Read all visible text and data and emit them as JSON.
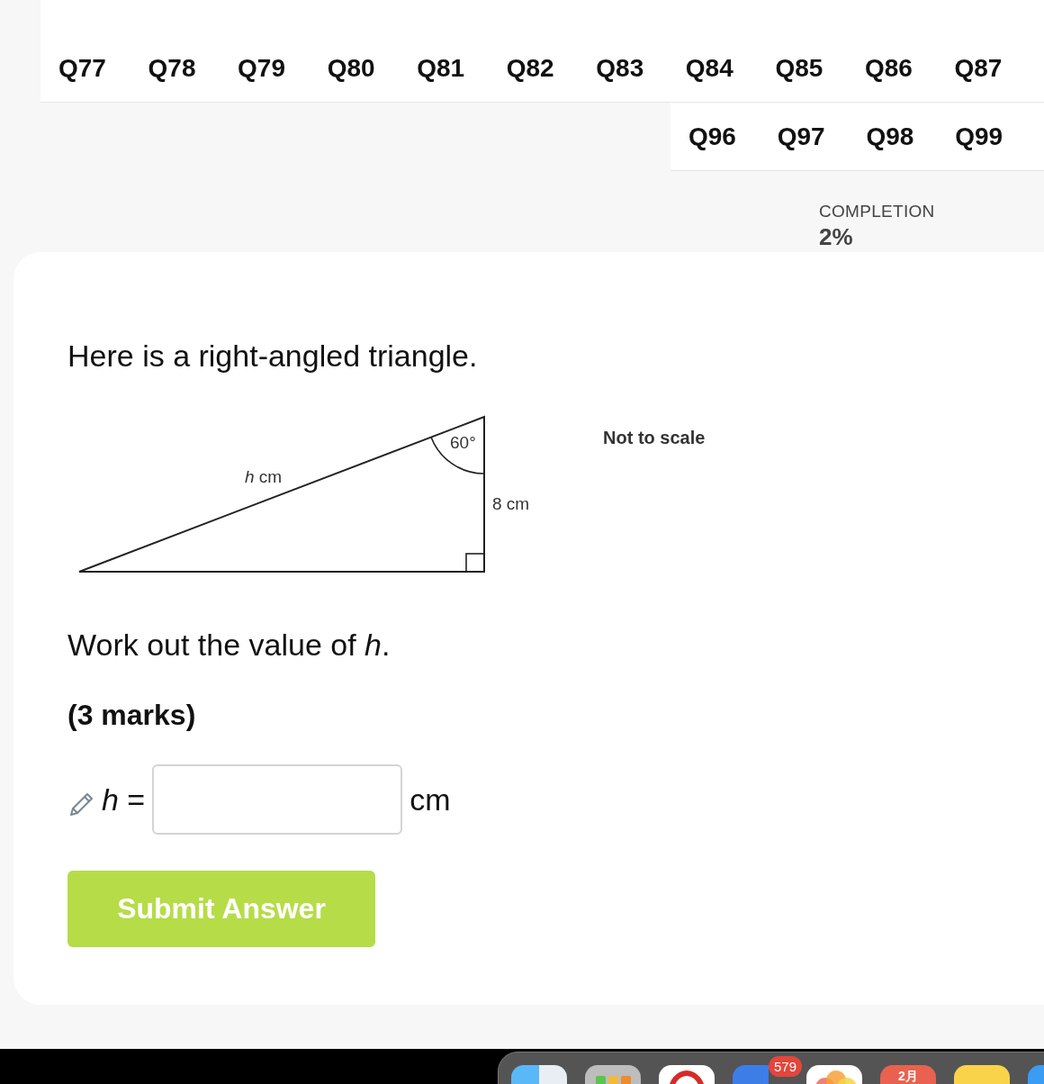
{
  "question_nav": {
    "rows": [
      {
        "items": [
          "Q77",
          "Q78",
          "Q79",
          "Q80",
          "Q81",
          "Q82",
          "Q83",
          "Q84",
          "Q85",
          "Q86",
          "Q87"
        ]
      },
      {
        "items": [
          "Q96",
          "Q97",
          "Q98",
          "Q99"
        ]
      }
    ]
  },
  "completion": {
    "label": "COMPLETION",
    "value": "2%"
  },
  "question": {
    "intro": "Here is a right-angled triangle.",
    "figure": {
      "angle_label": "60°",
      "hypotenuse_label": "*h* cm",
      "side_label": "8 cm",
      "note": "Not to scale"
    },
    "prompt": "Work out the value of *h*.",
    "marks": "(3 marks)",
    "answer": {
      "variable": "*h* =",
      "unit": "cm"
    },
    "submit": "Submit Answer"
  },
  "dock": {
    "apps": [
      {
        "kind": "finder"
      },
      {
        "kind": "launchpad"
      },
      {
        "kind": "opera"
      },
      {
        "kind": "mail",
        "badge": "579"
      },
      {
        "kind": "photos"
      },
      {
        "kind": "calendar",
        "label": "2月"
      },
      {
        "kind": "notes"
      },
      {
        "kind": "blue"
      }
    ]
  }
}
